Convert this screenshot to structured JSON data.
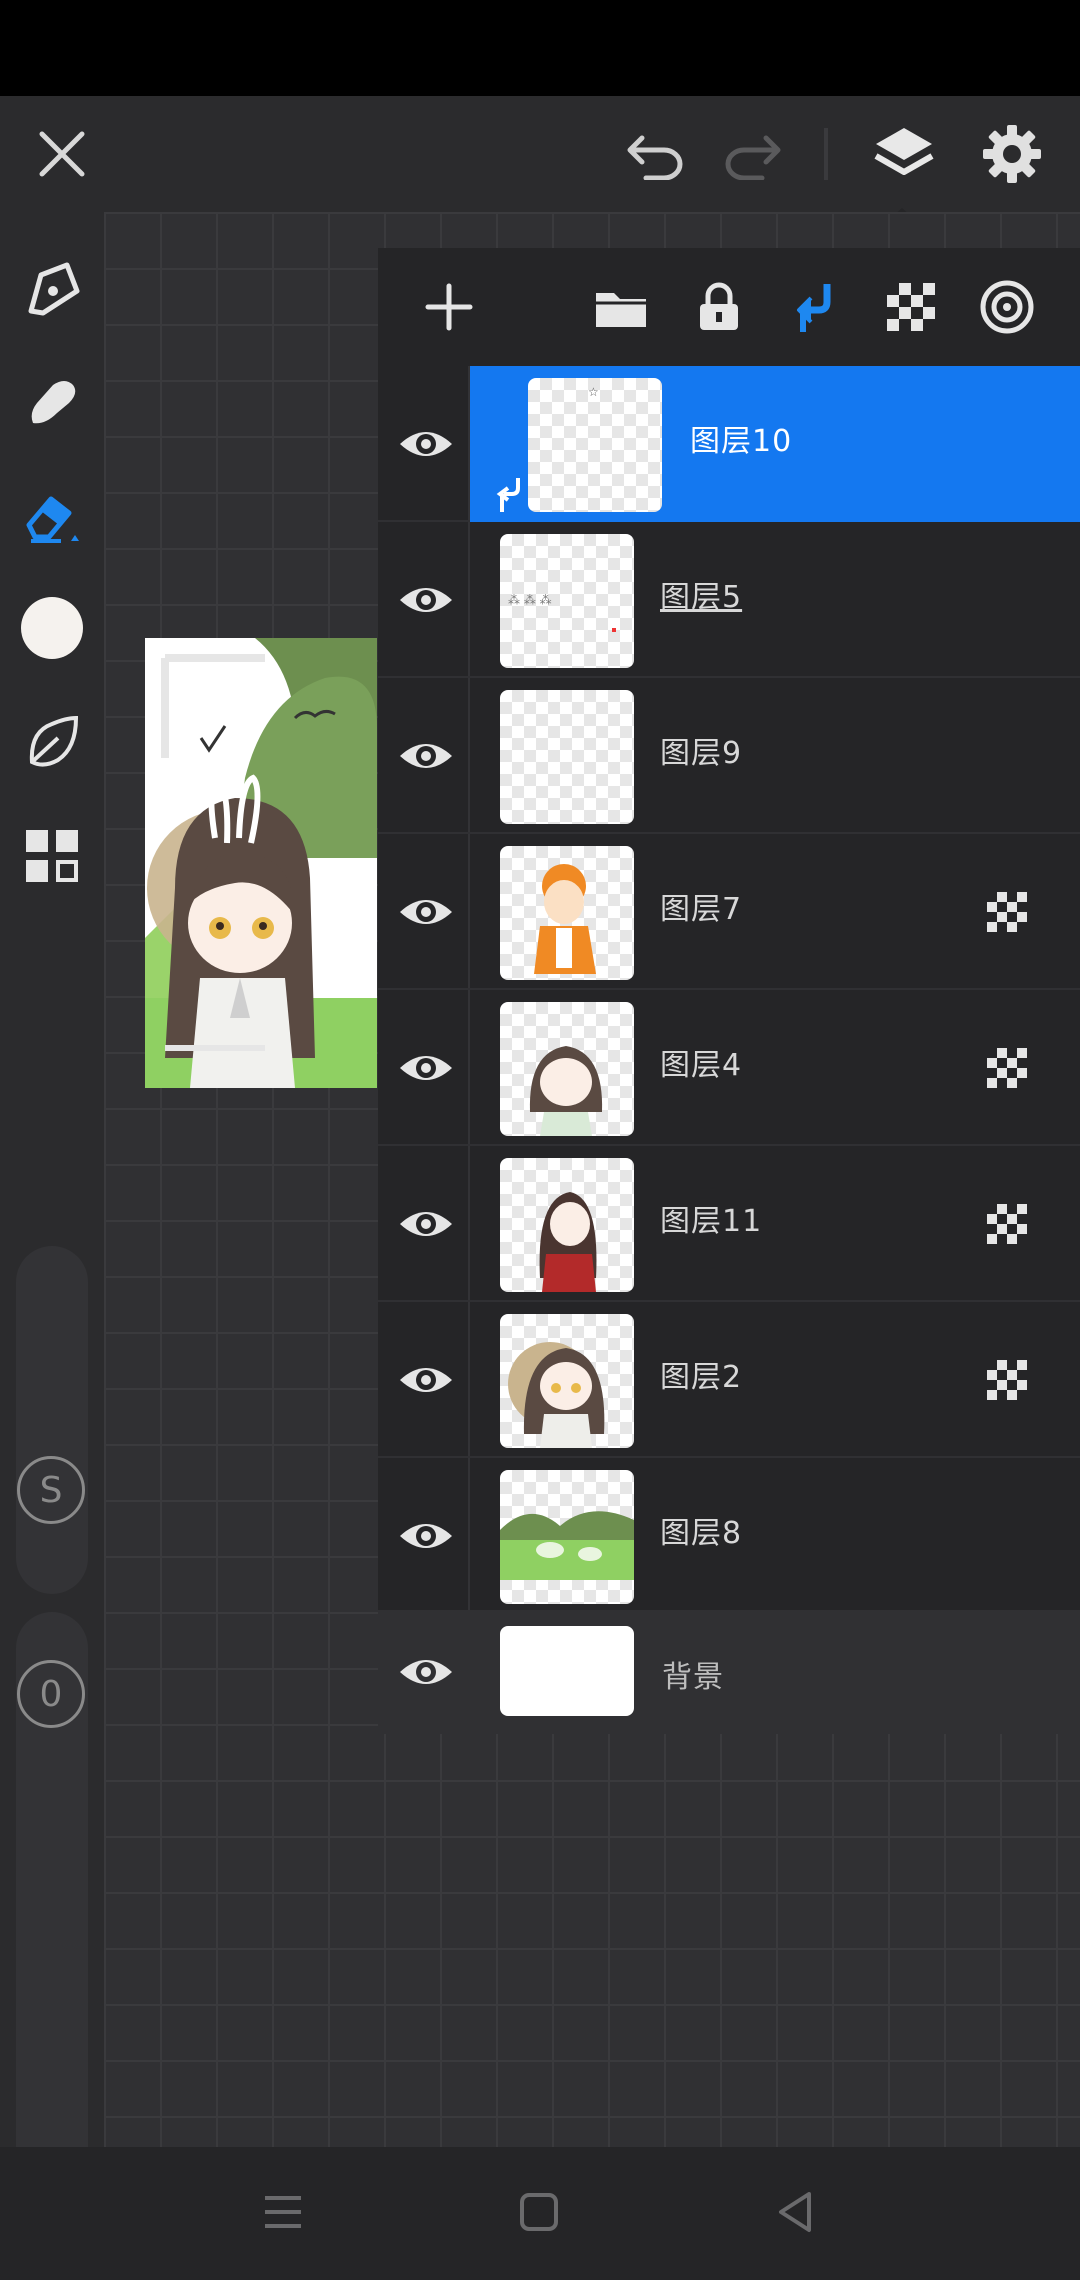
{
  "app": {
    "name": "drawing-app"
  },
  "topbar": {
    "icons": [
      "close-icon",
      "undo-icon",
      "redo-icon",
      "layers-icon",
      "gear-icon"
    ]
  },
  "left_toolbar": {
    "tools": [
      "pen-icon",
      "smudge-icon",
      "eraser-icon",
      "color-swatch",
      "leaf-icon",
      "grid-menu-icon"
    ],
    "active_tool": "eraser-icon",
    "current_color": "#f5f2ee",
    "size_slider_label": "S",
    "opacity_slider_label": "0"
  },
  "layers_panel": {
    "toolbar_icons": [
      "add-layer-icon",
      "folder-icon",
      "lock-icon",
      "clip-mask-icon",
      "alpha-lock-icon",
      "blend-icon"
    ],
    "layers": [
      {
        "name": "图层10",
        "visible": true,
        "selected": true,
        "clipped": true,
        "alpha_locked": false,
        "underlined": false
      },
      {
        "name": "图层5",
        "visible": true,
        "selected": false,
        "clipped": false,
        "alpha_locked": false,
        "underlined": true
      },
      {
        "name": "图层9",
        "visible": true,
        "selected": false,
        "clipped": false,
        "alpha_locked": false,
        "underlined": false
      },
      {
        "name": "图层7",
        "visible": true,
        "selected": false,
        "clipped": false,
        "alpha_locked": true,
        "underlined": false
      },
      {
        "name": "图层4",
        "visible": true,
        "selected": false,
        "clipped": false,
        "alpha_locked": true,
        "underlined": false
      },
      {
        "name": "图层11",
        "visible": true,
        "selected": false,
        "clipped": false,
        "alpha_locked": true,
        "underlined": false
      },
      {
        "name": "图层2",
        "visible": true,
        "selected": false,
        "clipped": false,
        "alpha_locked": true,
        "underlined": false
      },
      {
        "name": "图层8",
        "visible": true,
        "selected": false,
        "clipped": false,
        "alpha_locked": false,
        "underlined": false
      }
    ],
    "background": {
      "name": "背景",
      "visible": true,
      "color": "#ffffff"
    }
  },
  "colors": {
    "accent": "#1478f0",
    "panel": "#252527",
    "canvas": "#303033"
  },
  "bottomnav": {
    "icons": [
      "menu-icon",
      "home-icon",
      "back-icon"
    ]
  }
}
